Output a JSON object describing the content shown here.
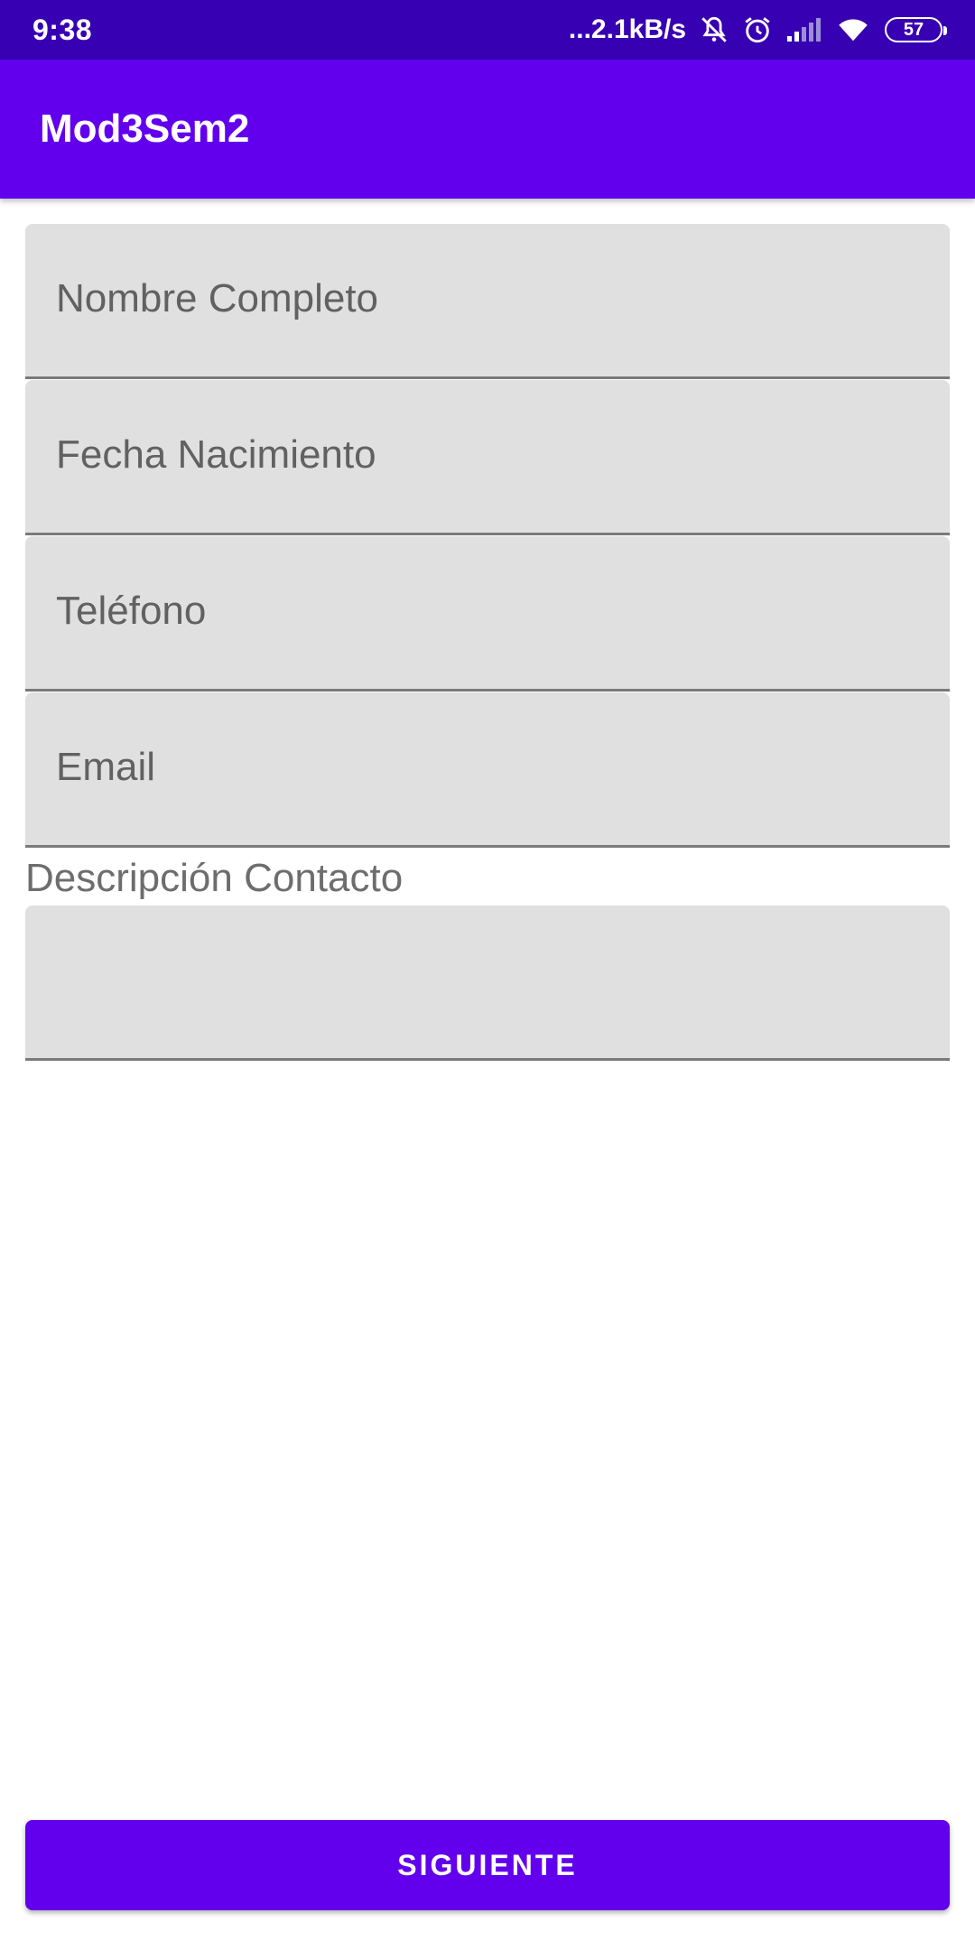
{
  "status_bar": {
    "time": "9:38",
    "network_speed": "...2.1kB/s",
    "battery": "57",
    "icons": [
      "bell-off-icon",
      "alarm-icon",
      "signal-icon",
      "wifi-icon",
      "battery-icon"
    ]
  },
  "app_bar": {
    "title": "Mod3Sem2",
    "color": "#6200ee"
  },
  "form": {
    "full_name_hint": "Nombre Completo",
    "birth_date_hint": "Fecha Nacimiento",
    "phone_hint": "Teléfono",
    "email_hint": "Email",
    "description_label": "Descripción Contacto",
    "description_value": ""
  },
  "next_button": {
    "label": "SIGUIENTE"
  },
  "colors": {
    "status_bar": "#3700b3",
    "primary": "#6200ee",
    "field_background": "#e0e0e0"
  }
}
